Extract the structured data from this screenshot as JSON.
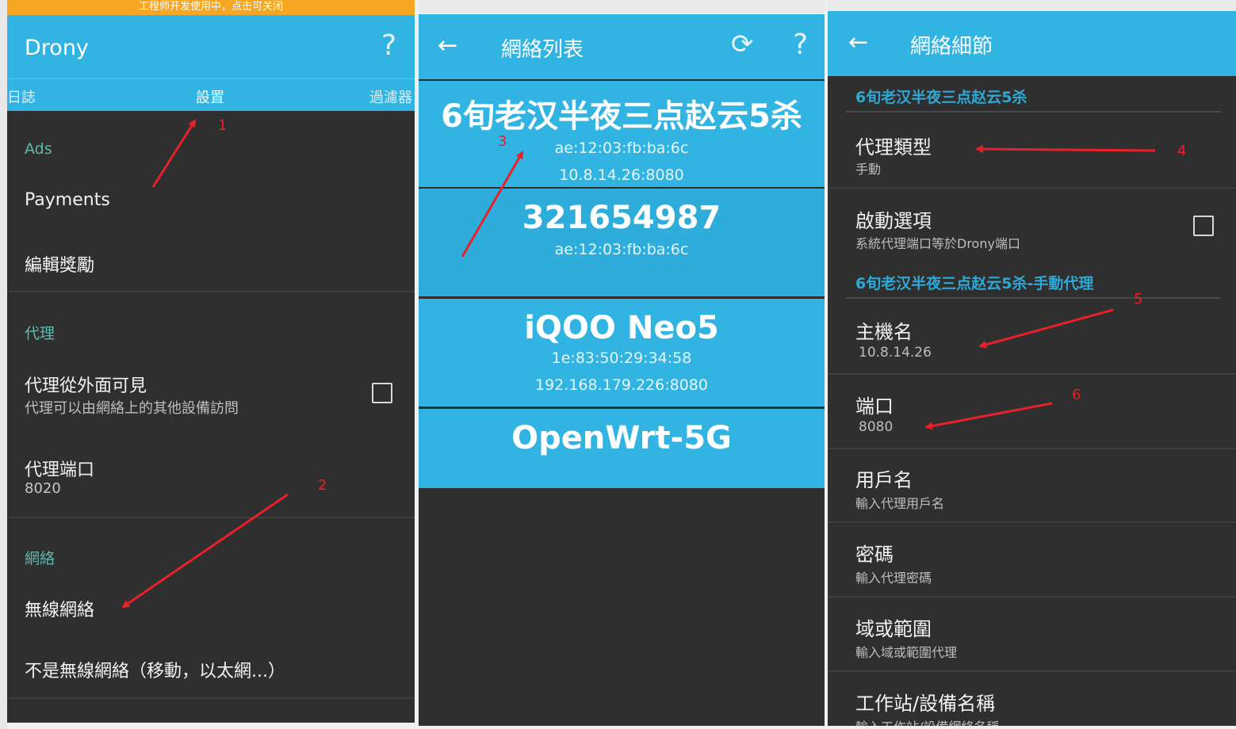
{
  "panel1": {
    "banner": "工程师开发使用中，点击可关闭",
    "app_title": "Drony",
    "help_glyph": "?",
    "tabs": [
      "日誌",
      "設置",
      "過濾器"
    ],
    "sections": {
      "ads": "Ads",
      "payments": "Payments",
      "edit_rewards": "編輯獎勵",
      "proxy": "代理",
      "proxy_visible_title": "代理從外面可見",
      "proxy_visible_sub": "代理可以由網絡上的其他設備訪問",
      "proxy_port_title": "代理端口",
      "proxy_port_value": "8020",
      "network": "網絡",
      "wifi": "無線網絡",
      "not_wifi": "不是無線網絡（移動，以太網...）"
    }
  },
  "panel2": {
    "title": "網絡列表",
    "help_glyph": "?",
    "networks": [
      {
        "name": "6旬老汉半夜三点赵云5杀",
        "mac": "ae:12:03:fb:ba:6c",
        "addr": "10.8.14.26:8080"
      },
      {
        "name": "321654987",
        "mac": "ae:12:03:fb:ba:6c",
        "addr": ""
      },
      {
        "name": "iQOO Neo5",
        "mac": "1e:83:50:29:34:58",
        "addr": "192.168.179.226:8080"
      },
      {
        "name": "OpenWrt-5G",
        "mac": "",
        "addr": ""
      }
    ]
  },
  "panel3": {
    "title": "網絡細節",
    "header1": "6旬老汉半夜三点赵云5杀",
    "proxy_type_title": "代理類型",
    "proxy_type_value": "手動",
    "startup_title": "啟動選項",
    "startup_sub": "系統代理端口等於Drony端口",
    "header2": "6旬老汉半夜三点赵云5杀-手動代理",
    "hostname_title": "主機名",
    "hostname_value": "10.8.14.26",
    "port_title": "端口",
    "port_value": "8080",
    "username_title": "用戶名",
    "username_sub": "輸入代理用戶名",
    "password_title": "密碼",
    "password_sub": "輸入代理密碼",
    "domain_title": "域或範圍",
    "domain_sub": "輸入域或範圍代理",
    "workstation_title": "工作站/設備名稱",
    "workstation_sub": "輸入工作站/設備網絡名稱"
  },
  "annotations": [
    "1",
    "2",
    "3",
    "4",
    "5",
    "6"
  ],
  "colors": {
    "appbar": "#31b4e2",
    "dark_bg": "#2f2f2f",
    "banner": "#f5a623",
    "arrow": "#e8202a",
    "section": "#5fb9b0"
  }
}
